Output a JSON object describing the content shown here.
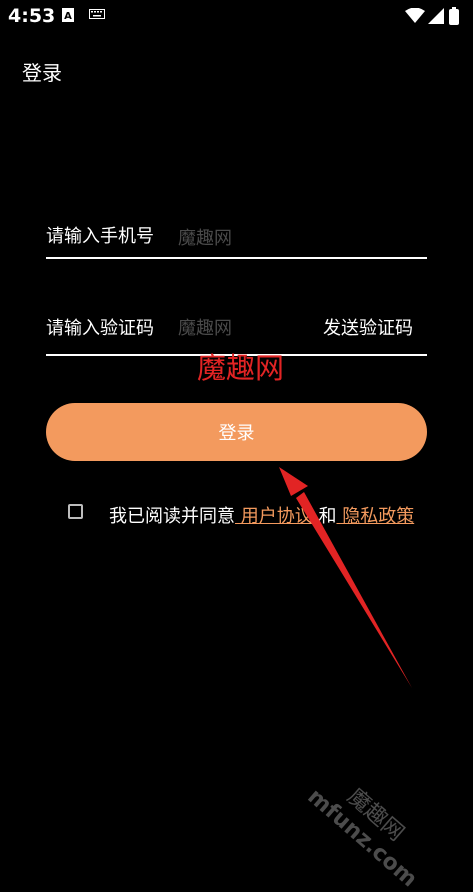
{
  "status_bar": {
    "time": "4:53",
    "icons": [
      "font-a-icon",
      "keyboard-icon",
      "wifi-icon",
      "signal-icon",
      "battery-icon"
    ]
  },
  "app_bar": {
    "title": "登录"
  },
  "phone_field": {
    "label": "请输入手机号",
    "value": "",
    "placeholder": "魔趣网"
  },
  "code_field": {
    "label": "请输入验证码",
    "value": "",
    "placeholder": "魔趣网",
    "send_code_label": "发送验证码"
  },
  "login_button": {
    "label": "登录"
  },
  "agreement": {
    "checked": false,
    "text_prefix": "我已阅读并同意",
    "user_agreement": " 用户协议",
    "and": " 和",
    "privacy_policy": " 隐私政策"
  },
  "watermark": {
    "center_text": "魔趣网",
    "corner_cn": "魔趣网",
    "corner_en": "mfunz.com"
  },
  "colors": {
    "background": "#000000",
    "accent": "#f39a5e",
    "watermark_red": "#e22424"
  }
}
